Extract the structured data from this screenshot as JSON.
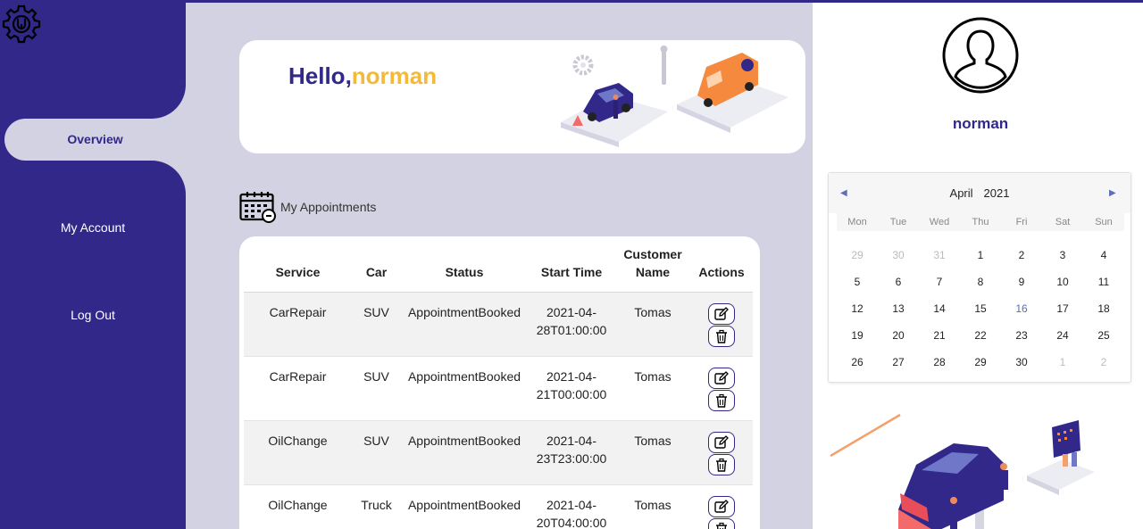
{
  "hero": {
    "greeting": "Hello,",
    "username": "norman"
  },
  "sidebar": {
    "items": [
      {
        "label": "Overview",
        "active": true
      },
      {
        "label": "My Account",
        "active": false
      },
      {
        "label": "Log Out",
        "active": false
      }
    ]
  },
  "appointments": {
    "title": "My Appointments",
    "columns": [
      "Service",
      "Car",
      "Status",
      "Start Time",
      "Customer Name",
      "Actions"
    ],
    "rows": [
      {
        "service": "CarRepair",
        "car": "SUV",
        "status": "AppointmentBooked",
        "start_time": "2021-04-28T01:00:00",
        "customer": "Tomas"
      },
      {
        "service": "CarRepair",
        "car": "SUV",
        "status": "AppointmentBooked",
        "start_time": "2021-04-21T00:00:00",
        "customer": "Tomas"
      },
      {
        "service": "OilChange",
        "car": "SUV",
        "status": "AppointmentBooked",
        "start_time": "2021-04-23T23:00:00",
        "customer": "Tomas"
      },
      {
        "service": "OilChange",
        "car": "Truck",
        "status": "AppointmentBooked",
        "start_time": "2021-04-20T04:00:00",
        "customer": "Tomas"
      }
    ]
  },
  "profile": {
    "name": "norman"
  },
  "calendar": {
    "month": "April",
    "year": "2021",
    "weekdays": [
      "Mon",
      "Tue",
      "Wed",
      "Thu",
      "Fri",
      "Sat",
      "Sun"
    ],
    "weeks": [
      [
        [
          "29",
          "muted"
        ],
        [
          "30",
          "muted"
        ],
        [
          "31",
          "muted"
        ],
        [
          "1",
          ""
        ],
        [
          "2",
          ""
        ],
        [
          "3",
          ""
        ],
        [
          "4",
          ""
        ]
      ],
      [
        [
          "5",
          ""
        ],
        [
          "6",
          ""
        ],
        [
          "7",
          ""
        ],
        [
          "8",
          ""
        ],
        [
          "9",
          ""
        ],
        [
          "10",
          ""
        ],
        [
          "11",
          ""
        ]
      ],
      [
        [
          "12",
          ""
        ],
        [
          "13",
          ""
        ],
        [
          "14",
          ""
        ],
        [
          "15",
          ""
        ],
        [
          "16",
          "today"
        ],
        [
          "17",
          ""
        ],
        [
          "18",
          ""
        ]
      ],
      [
        [
          "19",
          ""
        ],
        [
          "20",
          ""
        ],
        [
          "21",
          ""
        ],
        [
          "22",
          ""
        ],
        [
          "23",
          ""
        ],
        [
          "24",
          ""
        ],
        [
          "25",
          ""
        ]
      ],
      [
        [
          "26",
          ""
        ],
        [
          "27",
          ""
        ],
        [
          "28",
          ""
        ],
        [
          "29",
          ""
        ],
        [
          "30",
          ""
        ],
        [
          "1",
          "muted"
        ],
        [
          "2",
          "muted"
        ]
      ]
    ]
  },
  "colors": {
    "brand": "#32288a",
    "accent": "#f3b93a",
    "background": "#d3d2e2",
    "today": "#5b6fb5"
  },
  "icons": [
    "gear-logo-icon",
    "calendar-icon",
    "edit-icon",
    "trash-icon",
    "user-avatar-icon",
    "prev-month-icon",
    "next-month-icon"
  ]
}
